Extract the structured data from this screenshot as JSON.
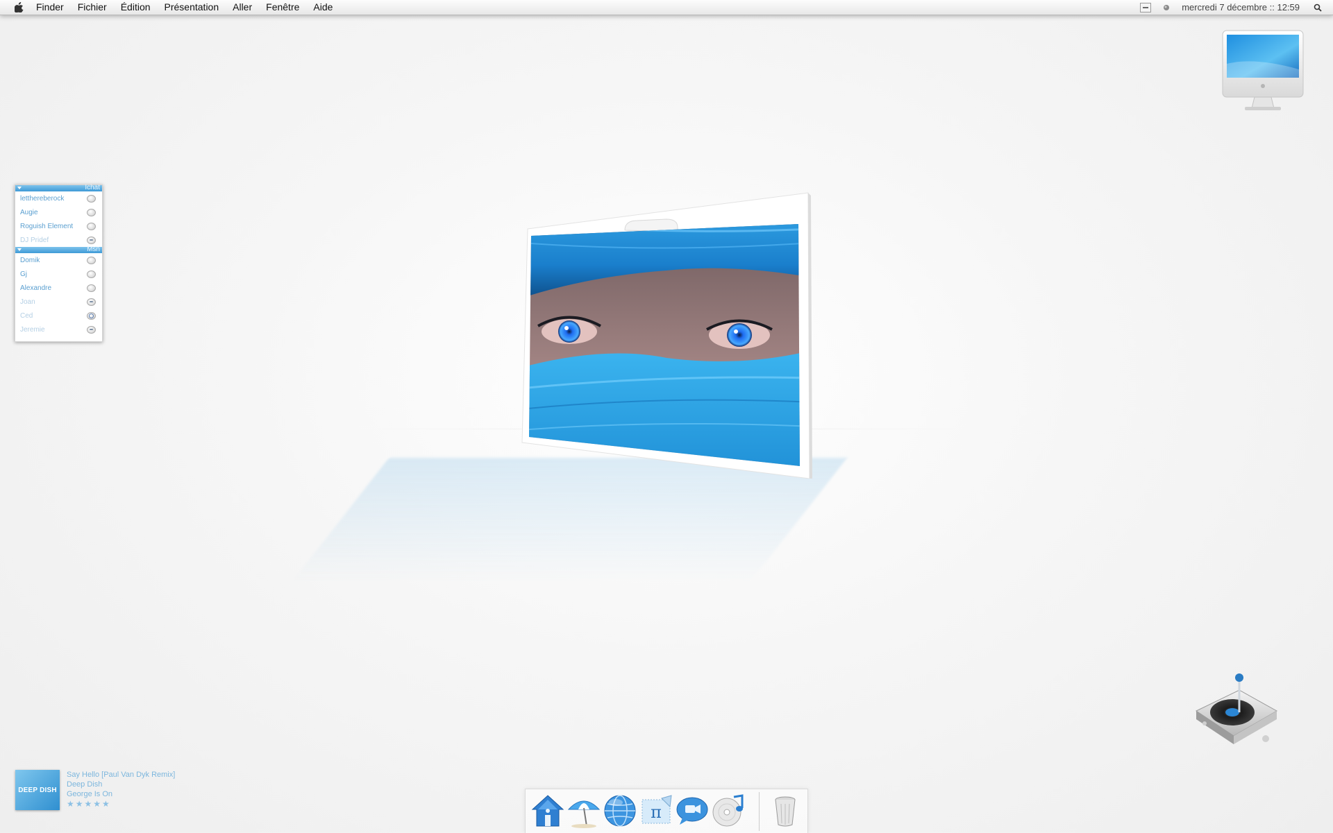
{
  "menubar": {
    "items": [
      "Finder",
      "Fichier",
      "Édition",
      "Présentation",
      "Aller",
      "Fenêtre",
      "Aide"
    ],
    "clock": "mercredi 7 décembre :: 12:59",
    "icons": [
      "apple-icon",
      "menu-extra-icon",
      "volume-icon",
      "spotlight-icon"
    ]
  },
  "buddy_list": {
    "groups": [
      {
        "name": "Ichat",
        "buddies": [
          {
            "name": "letthereberock",
            "status": "available"
          },
          {
            "name": "Augie",
            "status": "available"
          },
          {
            "name": "Roguish Element",
            "status": "available"
          },
          {
            "name": "DJ Pridef",
            "status": "idle"
          }
        ]
      },
      {
        "name": "Msn",
        "buddies": [
          {
            "name": "Domik",
            "status": "available"
          },
          {
            "name": "Gj",
            "status": "available"
          },
          {
            "name": "Alexandre",
            "status": "available"
          },
          {
            "name": "Joan",
            "status": "idle"
          },
          {
            "name": "Ced",
            "status": "camera"
          },
          {
            "name": "Jeremie",
            "status": "idle"
          }
        ]
      }
    ]
  },
  "now_playing": {
    "album_art": "DEEP DISH",
    "title": "Say Hello [Paul Van Dyk Remix]",
    "artist": "Deep Dish",
    "album": "George Is On",
    "rating_stars": "★★★★★"
  },
  "desktop": {
    "icons": [
      "hard-drive-icon",
      "dj-turntable-icon"
    ],
    "photo": "blue-eyes-photo"
  },
  "dock": {
    "items": [
      "home-icon",
      "beach-umbrella-icon",
      "globe-icon",
      "pi-stamp-icon",
      "ichat-icon",
      "itunes-icon"
    ],
    "trash": "trash-icon"
  },
  "colors": {
    "accent": "#3e9ad6",
    "buddy_text": "#5a9fd0",
    "photo_blue": "#2aa0e0"
  }
}
